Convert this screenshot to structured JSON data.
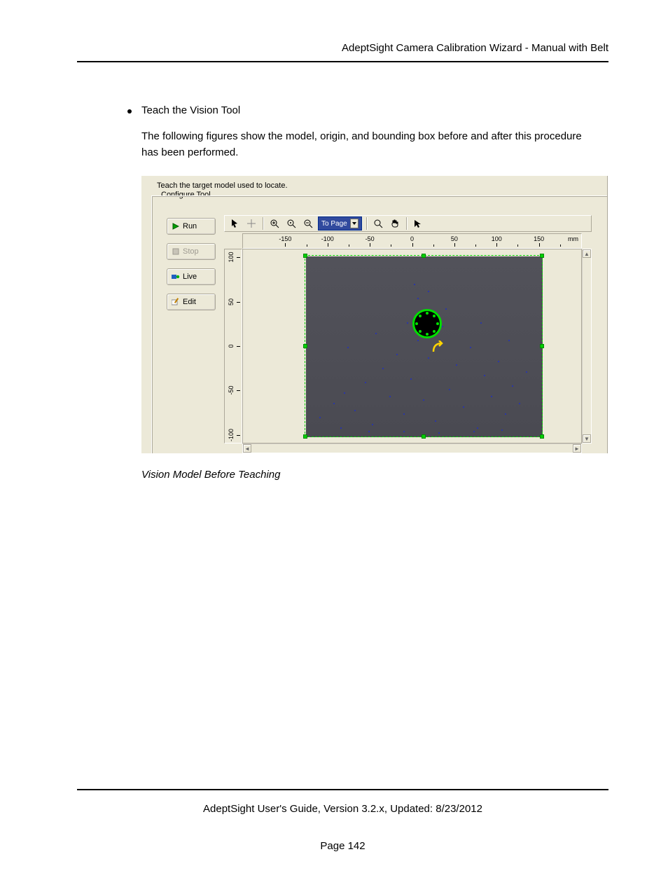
{
  "header": {
    "title": "AdeptSight Camera Calibration Wizard - Manual with Belt"
  },
  "content": {
    "bullet": "Teach the Vision Tool",
    "para": "The following figures show the model, origin, and bounding box before and after this procedure has been performed.",
    "caption": "Vision Model Before Teaching"
  },
  "app": {
    "teach_text": "Teach the target model used to locate.",
    "group_label": "Configure Tool",
    "buttons": {
      "run": "Run",
      "stop": "Stop",
      "live": "Live",
      "edit": "Edit"
    },
    "toolbar": {
      "dropdown": "To Page"
    },
    "ruler": {
      "x_ticks": [
        "-150",
        "-100",
        "-50",
        "0",
        "50",
        "100",
        "150"
      ],
      "x_unit": "mm",
      "y_ticks": [
        "100",
        "50",
        "0",
        "-50",
        "-100"
      ]
    }
  },
  "footer": {
    "line": "AdeptSight User's Guide,  Version 3.2.x, Updated: 8/23/2012",
    "page": "Page 142"
  }
}
